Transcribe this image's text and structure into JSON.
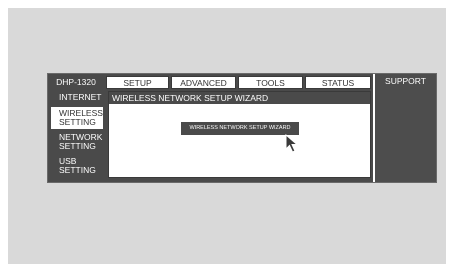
{
  "header": {
    "model": "DHP-1320",
    "tabs": {
      "setup": "SETUP",
      "advanced": "ADVANCED",
      "tools": "TOOLS",
      "status": "STATUS",
      "support": "SUPPORT"
    }
  },
  "sidebar": {
    "items": [
      {
        "line1": "INTERNET",
        "line2": ""
      },
      {
        "line1": "WIRELESS",
        "line2": "SETTING"
      },
      {
        "line1": "NETWORK",
        "line2": "SETTING"
      },
      {
        "line1": "USB",
        "line2": "SETTING"
      }
    ]
  },
  "main": {
    "panel_title": "WIRELESS NETWORK SETUP WIZARD",
    "wizard_button": "WIRELESS NETWORK SETUP WIZARD"
  },
  "icons": {
    "pointer": "mouse-pointer-icon"
  },
  "colors": {
    "bar_dark": "#4a4a4a",
    "background": "#d9d9d9"
  }
}
